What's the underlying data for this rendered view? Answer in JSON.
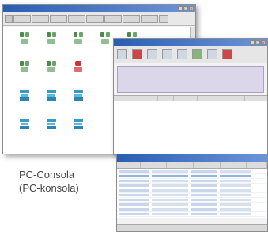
{
  "caption": {
    "line1": "PC-Consola",
    "line2": "(PC-konsola)"
  },
  "colors": {
    "titlebar": "#2a5db3",
    "caption_text": "#444444",
    "selection": "#93b3dc"
  },
  "window_buttons": {
    "minimize": "_",
    "maximize": "□",
    "close": "×"
  }
}
